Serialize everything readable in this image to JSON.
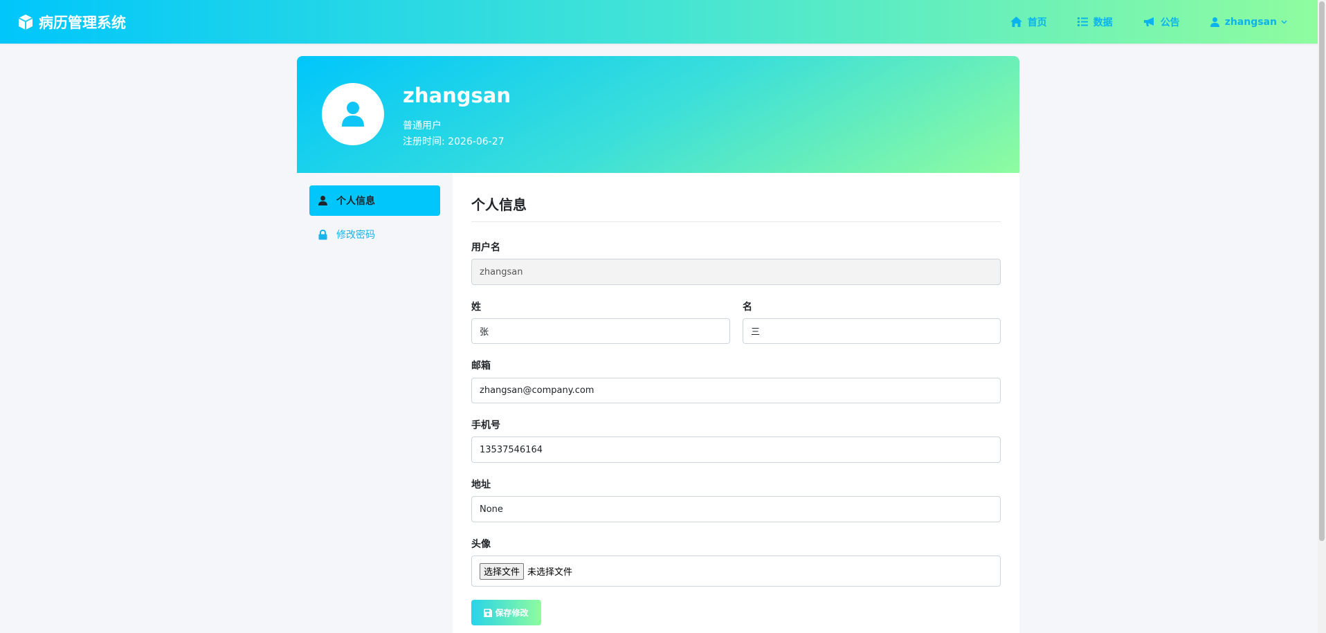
{
  "nav": {
    "brand": "病历管理系统",
    "items": [
      {
        "label": "首页",
        "icon": "home-icon"
      },
      {
        "label": "数据",
        "icon": "list-icon"
      },
      {
        "label": "公告",
        "icon": "megaphone-icon"
      }
    ],
    "user": {
      "label": "zhangsan",
      "icon": "user-icon"
    }
  },
  "profile": {
    "username": "zhangsan",
    "role": "普通用户",
    "registered": "注册时间: 2026-06-27"
  },
  "sidebar": {
    "items": [
      {
        "label": "个人信息",
        "icon": "user-icon",
        "active": true
      },
      {
        "label": "修改密码",
        "icon": "lock-icon",
        "active": false
      }
    ]
  },
  "form": {
    "title": "个人信息",
    "username": {
      "label": "用户名",
      "value": "zhangsan"
    },
    "last_name": {
      "label": "姓",
      "value": "张"
    },
    "first_name": {
      "label": "名",
      "value": "三"
    },
    "email": {
      "label": "邮箱",
      "value": "zhangsan@company.com"
    },
    "phone": {
      "label": "手机号",
      "value": "13537546164"
    },
    "address": {
      "label": "地址",
      "value": "None"
    },
    "avatar": {
      "label": "头像",
      "button": "选择文件",
      "status": "未选择文件"
    },
    "save_label": "保存修改"
  },
  "colors": {
    "gradient_start": "#00c6fb",
    "gradient_end": "#8ffc9f",
    "accent": "#0ab3f0"
  }
}
